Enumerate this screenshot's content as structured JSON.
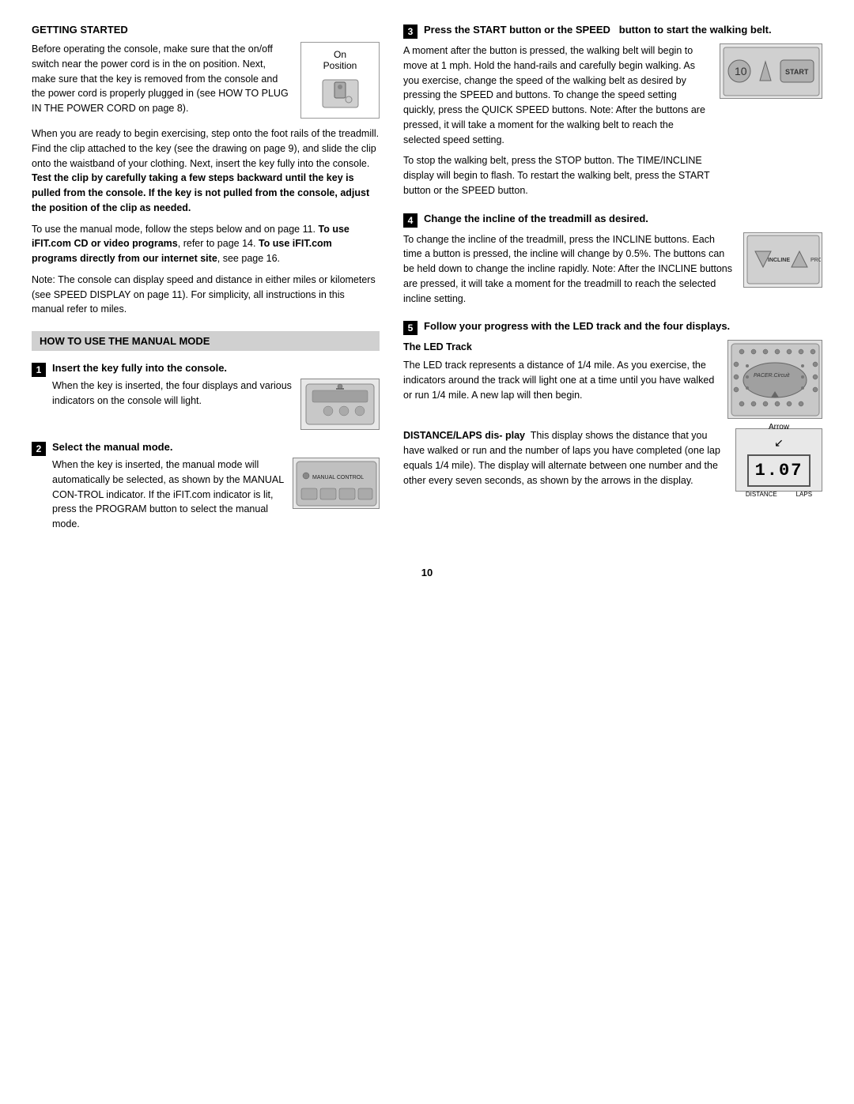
{
  "left": {
    "getting_started_title": "GETTING STARTED",
    "gs_para1": "Before operating the console, make sure that the on/off switch near the power cord is in the on position. Next, make sure that the key is removed from the console and the power cord is properly plugged in (see HOW TO PLUG IN THE POWER CORD on page 8).",
    "on_position_label": "On\nPosition",
    "gs_para2": "When you are ready to begin exercising, step onto the foot rails of the treadmill. Find the clip attached to the key (see the drawing on page 9), and slide the clip onto the waistband of your clothing. Next, insert the key fully into the console.",
    "gs_para2_bold": "Test the clip by carefully taking a few steps backward until the key is pulled from the console. If the key is not pulled from the console, adjust the position of the clip as needed.",
    "gs_para3_intro": "To use the manual mode, follow the steps below and on page 11.",
    "gs_para3_ifit": "To use iFIT.com CD or video programs,",
    "gs_para3_ifit_cont": "refer to page 14.",
    "gs_para3_direct": "To use iFIT.com programs directly from our internet site,",
    "gs_para3_direct_cont": "see page 16.",
    "gs_para4": "Note: The console can display speed and distance in either miles or kilometers (see SPEED DISPLAY on page 11). For simplicity, all instructions in this manual refer to miles.",
    "how_to_title": "HOW TO USE THE MANUAL MODE",
    "step1_title": "Insert the key fully into the console.",
    "step1_text": "When the key is inserted, the four displays and various indicators on the console will light.",
    "step2_title": "Select the manual mode.",
    "step2_text": "When the key is inserted, the manual mode will automatically be selected, as shown by the MANUAL CON-TROL indicator. If the iFIT.com indicator is lit, press the PROGRAM button to select the manual mode.",
    "manual_control_label": "MANUAL CONTROL"
  },
  "right": {
    "step3_number": "3",
    "step3_title": "Press the START button or the SPEED   button to start the walking belt.",
    "step3_para1": "A moment after the button is pressed, the walking belt will begin to move at 1 mph. Hold the hand-rails and carefully begin walking. As you exercise, change the speed of the walking belt as desired by pressing the SPEED and   buttons. To change the speed setting quickly, press the QUICK SPEED buttons. Note: After the buttons are pressed, it will take a moment for the walking belt to reach the selected speed setting.",
    "step3_para2": "To stop the walking belt, press the STOP button. The TIME/INCLINE display will begin to flash. To restart the walking belt, press the START button or the SPEED   button.",
    "step4_number": "4",
    "step4_title": "Change the incline of the treadmill as desired.",
    "step4_para": "To change the incline of the treadmill, press the INCLINE buttons. Each time a button is pressed, the incline will change by 0.5%. The buttons can be held down to change the incline rapidly. Note: After the INCLINE buttons are pressed, it will take a moment for the treadmill to reach the selected incline setting.",
    "step5_number": "5",
    "step5_title": "Follow your progress with the LED track and the four displays.",
    "led_track_title": "The LED Track",
    "led_track_text": "The LED track represents a distance of 1/4 mile. As you exercise, the indicators around the track will light one at a time until you have walked or run 1/4 mile. A new lap will then begin.",
    "distance_title": "DISTANCE/LAPS dis-",
    "distance_play": "play",
    "distance_text": "This display shows the distance that you have walked or run and the number of laps you have completed (one lap equals 1/4 mile). The display will alternate between one number and the other every seven seconds, as shown by the arrows in the display.",
    "display_number": "1.07",
    "arrow_label": "Arrow",
    "dist_label": "DISTANCE",
    "laps_label": "LAPS"
  },
  "page_number": "10"
}
